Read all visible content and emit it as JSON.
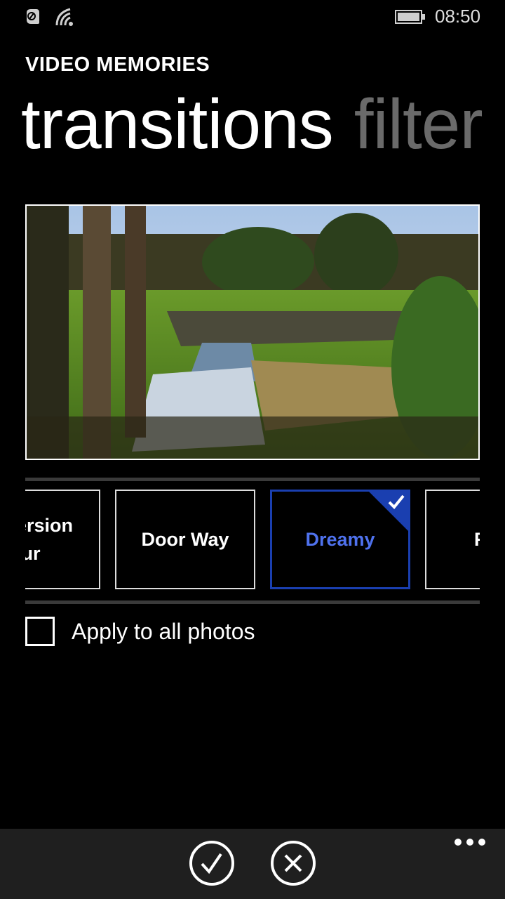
{
  "status_bar": {
    "icons": [
      "nfc-icon",
      "signal-icon",
      "battery-icon"
    ],
    "time": "08:50"
  },
  "app": {
    "title": "VIDEO MEMORIES"
  },
  "pivot": {
    "active": "transitions",
    "next": "filter"
  },
  "preview": {
    "description": "Photo of a small waterfall stream in a park with trees and grass"
  },
  "transitions": {
    "items": [
      {
        "label_line1": "ersion",
        "label_line2": "lur",
        "selected": false
      },
      {
        "label": "Door Way",
        "selected": false
      },
      {
        "label": "Dreamy",
        "selected": true
      },
      {
        "label": "F",
        "selected": false
      }
    ],
    "selected_color": "#1a3fb0",
    "selected_text_color": "#4f72ee"
  },
  "apply_all": {
    "label": "Apply to all photos",
    "checked": false
  },
  "app_bar": {
    "buttons": [
      "check-icon",
      "close-icon"
    ],
    "more": "more-icon"
  }
}
